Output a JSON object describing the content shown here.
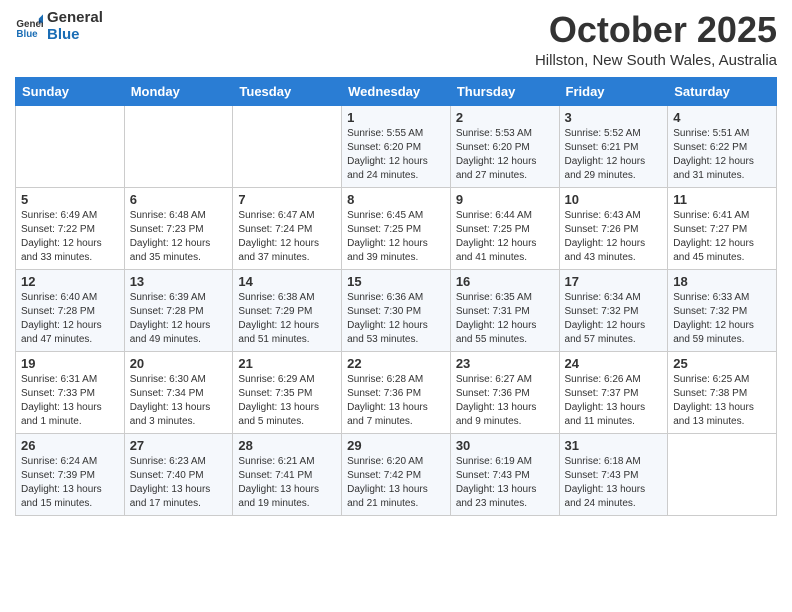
{
  "logo": {
    "line1": "General",
    "line2": "Blue"
  },
  "header": {
    "month": "October 2025",
    "location": "Hillston, New South Wales, Australia"
  },
  "weekdays": [
    "Sunday",
    "Monday",
    "Tuesday",
    "Wednesday",
    "Thursday",
    "Friday",
    "Saturday"
  ],
  "weeks": [
    [
      {
        "day": "",
        "info": ""
      },
      {
        "day": "",
        "info": ""
      },
      {
        "day": "",
        "info": ""
      },
      {
        "day": "1",
        "info": "Sunrise: 5:55 AM\nSunset: 6:20 PM\nDaylight: 12 hours and 24 minutes."
      },
      {
        "day": "2",
        "info": "Sunrise: 5:53 AM\nSunset: 6:20 PM\nDaylight: 12 hours and 27 minutes."
      },
      {
        "day": "3",
        "info": "Sunrise: 5:52 AM\nSunset: 6:21 PM\nDaylight: 12 hours and 29 minutes."
      },
      {
        "day": "4",
        "info": "Sunrise: 5:51 AM\nSunset: 6:22 PM\nDaylight: 12 hours and 31 minutes."
      }
    ],
    [
      {
        "day": "5",
        "info": "Sunrise: 6:49 AM\nSunset: 7:22 PM\nDaylight: 12 hours and 33 minutes."
      },
      {
        "day": "6",
        "info": "Sunrise: 6:48 AM\nSunset: 7:23 PM\nDaylight: 12 hours and 35 minutes."
      },
      {
        "day": "7",
        "info": "Sunrise: 6:47 AM\nSunset: 7:24 PM\nDaylight: 12 hours and 37 minutes."
      },
      {
        "day": "8",
        "info": "Sunrise: 6:45 AM\nSunset: 7:25 PM\nDaylight: 12 hours and 39 minutes."
      },
      {
        "day": "9",
        "info": "Sunrise: 6:44 AM\nSunset: 7:25 PM\nDaylight: 12 hours and 41 minutes."
      },
      {
        "day": "10",
        "info": "Sunrise: 6:43 AM\nSunset: 7:26 PM\nDaylight: 12 hours and 43 minutes."
      },
      {
        "day": "11",
        "info": "Sunrise: 6:41 AM\nSunset: 7:27 PM\nDaylight: 12 hours and 45 minutes."
      }
    ],
    [
      {
        "day": "12",
        "info": "Sunrise: 6:40 AM\nSunset: 7:28 PM\nDaylight: 12 hours and 47 minutes."
      },
      {
        "day": "13",
        "info": "Sunrise: 6:39 AM\nSunset: 7:28 PM\nDaylight: 12 hours and 49 minutes."
      },
      {
        "day": "14",
        "info": "Sunrise: 6:38 AM\nSunset: 7:29 PM\nDaylight: 12 hours and 51 minutes."
      },
      {
        "day": "15",
        "info": "Sunrise: 6:36 AM\nSunset: 7:30 PM\nDaylight: 12 hours and 53 minutes."
      },
      {
        "day": "16",
        "info": "Sunrise: 6:35 AM\nSunset: 7:31 PM\nDaylight: 12 hours and 55 minutes."
      },
      {
        "day": "17",
        "info": "Sunrise: 6:34 AM\nSunset: 7:32 PM\nDaylight: 12 hours and 57 minutes."
      },
      {
        "day": "18",
        "info": "Sunrise: 6:33 AM\nSunset: 7:32 PM\nDaylight: 12 hours and 59 minutes."
      }
    ],
    [
      {
        "day": "19",
        "info": "Sunrise: 6:31 AM\nSunset: 7:33 PM\nDaylight: 13 hours and 1 minute."
      },
      {
        "day": "20",
        "info": "Sunrise: 6:30 AM\nSunset: 7:34 PM\nDaylight: 13 hours and 3 minutes."
      },
      {
        "day": "21",
        "info": "Sunrise: 6:29 AM\nSunset: 7:35 PM\nDaylight: 13 hours and 5 minutes."
      },
      {
        "day": "22",
        "info": "Sunrise: 6:28 AM\nSunset: 7:36 PM\nDaylight: 13 hours and 7 minutes."
      },
      {
        "day": "23",
        "info": "Sunrise: 6:27 AM\nSunset: 7:36 PM\nDaylight: 13 hours and 9 minutes."
      },
      {
        "day": "24",
        "info": "Sunrise: 6:26 AM\nSunset: 7:37 PM\nDaylight: 13 hours and 11 minutes."
      },
      {
        "day": "25",
        "info": "Sunrise: 6:25 AM\nSunset: 7:38 PM\nDaylight: 13 hours and 13 minutes."
      }
    ],
    [
      {
        "day": "26",
        "info": "Sunrise: 6:24 AM\nSunset: 7:39 PM\nDaylight: 13 hours and 15 minutes."
      },
      {
        "day": "27",
        "info": "Sunrise: 6:23 AM\nSunset: 7:40 PM\nDaylight: 13 hours and 17 minutes."
      },
      {
        "day": "28",
        "info": "Sunrise: 6:21 AM\nSunset: 7:41 PM\nDaylight: 13 hours and 19 minutes."
      },
      {
        "day": "29",
        "info": "Sunrise: 6:20 AM\nSunset: 7:42 PM\nDaylight: 13 hours and 21 minutes."
      },
      {
        "day": "30",
        "info": "Sunrise: 6:19 AM\nSunset: 7:43 PM\nDaylight: 13 hours and 23 minutes."
      },
      {
        "day": "31",
        "info": "Sunrise: 6:18 AM\nSunset: 7:43 PM\nDaylight: 13 hours and 24 minutes."
      },
      {
        "day": "",
        "info": ""
      }
    ]
  ]
}
